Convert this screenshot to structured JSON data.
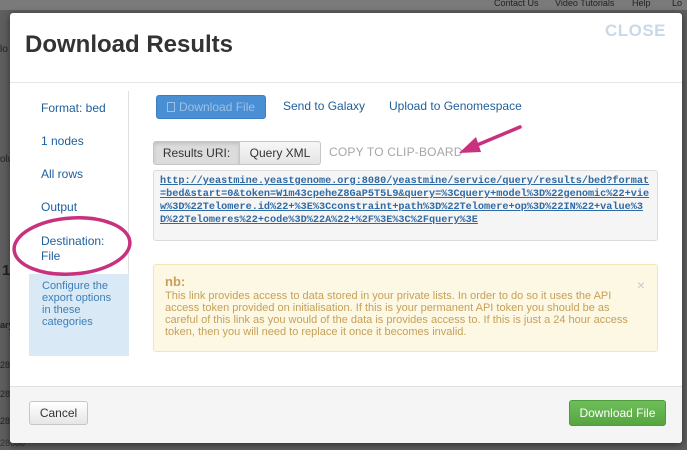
{
  "backdrop": {
    "top_links": [
      "Contact Us",
      "Video Tutorials",
      "Help",
      "Lo"
    ],
    "left_fragments": [
      "lo",
      "olu",
      "1",
      "ary",
      "28",
      "28",
      "28"
    ],
    "bottom_fragment": "28688"
  },
  "modal": {
    "title": "Download Results",
    "close_label": "CLOSE"
  },
  "sidebar": {
    "items": [
      {
        "label": "Format: bed"
      },
      {
        "label": "1 nodes"
      },
      {
        "label": "All rows"
      },
      {
        "label": "Output"
      },
      {
        "label": "Destination: File"
      }
    ],
    "help_text": "Configure the export options in these categories"
  },
  "destinations": {
    "download_file": "Download File",
    "send_to_galaxy": "Send to Galaxy",
    "upload_to_genomespace": "Upload to Genomespace"
  },
  "results": {
    "tab_uri": "Results URI:",
    "tab_xml": "Query XML",
    "copy_label": "COPY TO CLIP-BOARD",
    "url": "http://yeastmine.yeastgenome.org:8080/yeastmine/service/query/results/bed?format=bed&start=0&token=W1m43cpeheZ8GaP5T5L9&query=%3Cquery+model%3D%22genomic%22+view%3D%22Telomere.id%22+%3E%3Cconstraint+path%3D%22Telomere+op%3D%22IN%22+value%3D%22Telomeres%22+code%3D%22A%22+%2F%3E%3C%2Fquery%3E"
  },
  "notice": {
    "title": "nb:",
    "text": "This link provides access to data stored in your private lists. In order to do so it uses the API access token provided on initialisation. If this is your permanent API token you should be as careful of this link as you would of the data is provides access to. If this is just a 24 hour access token, then you will need to replace it once it becomes invalid.",
    "close_glyph": "×"
  },
  "footer": {
    "cancel_label": "Cancel",
    "download_label": "Download File"
  },
  "colors": {
    "link": "#1e5f9a",
    "primary": "#4a8fd3",
    "success": "#5cb247",
    "notice_bg": "#fcf8e3",
    "annotation": "#c8317d"
  }
}
